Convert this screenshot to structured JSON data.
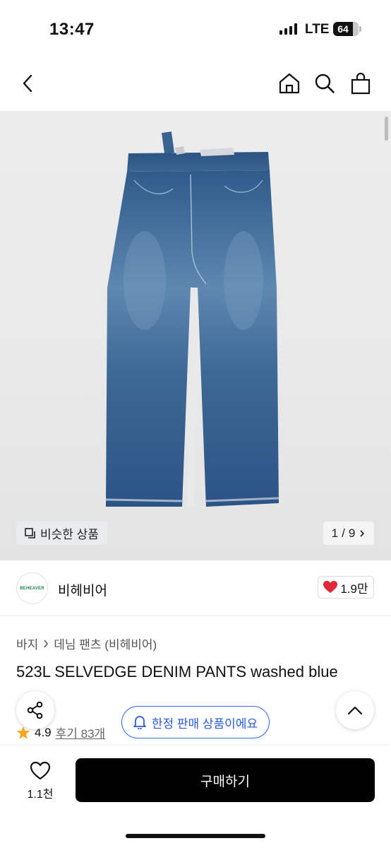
{
  "status_bar": {
    "time": "13:47",
    "network": "LTE",
    "battery": "64"
  },
  "nav": {
    "back_icon": "chevron-left-icon",
    "home_icon": "home-icon",
    "search_icon": "search-icon",
    "cart_icon": "shopping-bag-icon"
  },
  "gallery": {
    "similar_label": "비슷한 상품",
    "current": "1",
    "separator": "/",
    "total": "9"
  },
  "brand": {
    "logo_text": "BEHEAVER",
    "name": "비헤비어",
    "likes": "1.9만"
  },
  "product": {
    "breadcrumb": [
      "바지",
      "데님 팬츠 (비헤비어)"
    ],
    "title": "523L SELVEDGE DENIM PANTS washed blue",
    "rating": "4.9",
    "review_label": "후기 83개"
  },
  "floating": {
    "limited_label": "한정 판매 상품이에요"
  },
  "bottom_bar": {
    "wish_count": "1.1천",
    "buy_label": "구매하기"
  },
  "colors": {
    "accent_blue": "#2f6bff",
    "heart_red": "#e0283a",
    "star_orange": "#f5a623",
    "buy_button": "#000000"
  }
}
